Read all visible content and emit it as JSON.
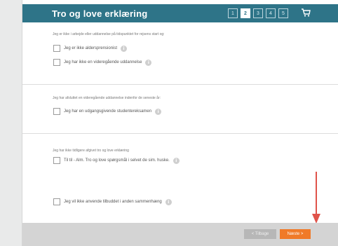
{
  "header": {
    "title": "Tro og love erklæring",
    "steps": [
      "1",
      "2",
      "3",
      "4",
      "5"
    ],
    "active_step": "2",
    "cart_icon": "cart-icon"
  },
  "sections": [
    {
      "description": "Jeg er ikke i arbejde eller uddannelse på tidspunktet for rejsens start og:",
      "options": [
        "Jeg er ikke aldersprensionist",
        "Jeg har ikke en videregående uddannelse"
      ]
    },
    {
      "description": "Jeg har afsluttet en videregående uddannelse indenfor de seneste år:",
      "options": [
        "Jeg har en udgangsgivende studentereksamen"
      ]
    },
    {
      "description": "Jeg har ikke tidligere afgivet tro og love erklæring",
      "options": [
        "Til til - Alm. Tro og love spørgsmål i selvet de sim. huske."
      ]
    },
    {
      "description": "",
      "options": [
        "Jeg vil ikke anvende tilbuddet i anden sammenhæng"
      ]
    }
  ],
  "info_icon": "info-icon",
  "footer": {
    "back_label": "< Tilbage",
    "next_label": "Næste >"
  },
  "colors": {
    "header_bg": "#2e7488",
    "next_button": "#f07a28",
    "annotation_arrow": "#e0534a"
  }
}
